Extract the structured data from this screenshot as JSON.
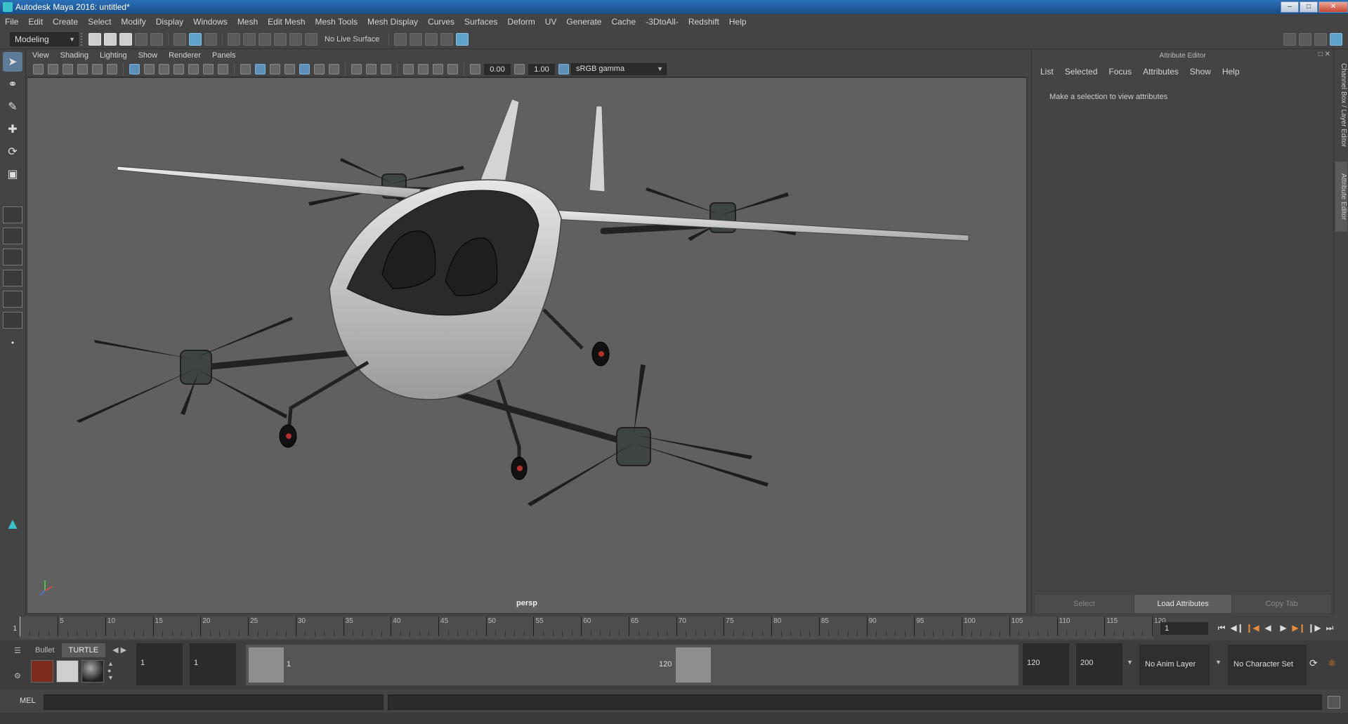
{
  "window": {
    "title": "Autodesk Maya 2016: untitled*"
  },
  "menubar": [
    "File",
    "Edit",
    "Create",
    "Select",
    "Modify",
    "Display",
    "Windows",
    "Mesh",
    "Edit Mesh",
    "Mesh Tools",
    "Mesh Display",
    "Curves",
    "Surfaces",
    "Deform",
    "UV",
    "Generate",
    "Cache",
    "-3DtoAll-",
    "Redshift",
    "Help"
  ],
  "toolbar": {
    "mode": "Modeling",
    "live_surface": "No Live Surface"
  },
  "viewport": {
    "menus": [
      "View",
      "Shading",
      "Lighting",
      "Show",
      "Renderer",
      "Panels"
    ],
    "exposure": "0.00",
    "gamma": "1.00",
    "color_space": "sRGB gamma",
    "camera": "persp"
  },
  "attribute_editor": {
    "title": "Attribute Editor",
    "menus": [
      "List",
      "Selected",
      "Focus",
      "Attributes",
      "Show",
      "Help"
    ],
    "message": "Make a selection to view attributes",
    "buttons": [
      "Select",
      "Load Attributes",
      "Copy Tab"
    ]
  },
  "side_tabs": [
    "Channel Box / Layer Editor",
    "Attribute Editor"
  ],
  "timeline": {
    "start": 1,
    "end": 120,
    "current_frame": "1",
    "labels": [
      "5",
      "10",
      "15",
      "20",
      "25",
      "30",
      "35",
      "40",
      "45",
      "50",
      "55",
      "60",
      "65",
      "70",
      "75",
      "80",
      "85",
      "90",
      "95",
      "100",
      "105",
      "110",
      "115",
      "120"
    ],
    "frame_field": "1"
  },
  "shelf": {
    "tabs": [
      "Bullet",
      "TURTLE"
    ]
  },
  "range": {
    "start_field": "1",
    "start_field2": "1",
    "range_start_label": "1",
    "range_end_label": "120",
    "end_field": "120",
    "end_field2": "200",
    "anim_layer": "No Anim Layer",
    "character_set": "No Character Set"
  },
  "cmdline": {
    "label": "MEL"
  },
  "colors": {
    "accent": "#5d7a99",
    "viewport_bg": "#606060",
    "panel_bg": "#444444"
  }
}
